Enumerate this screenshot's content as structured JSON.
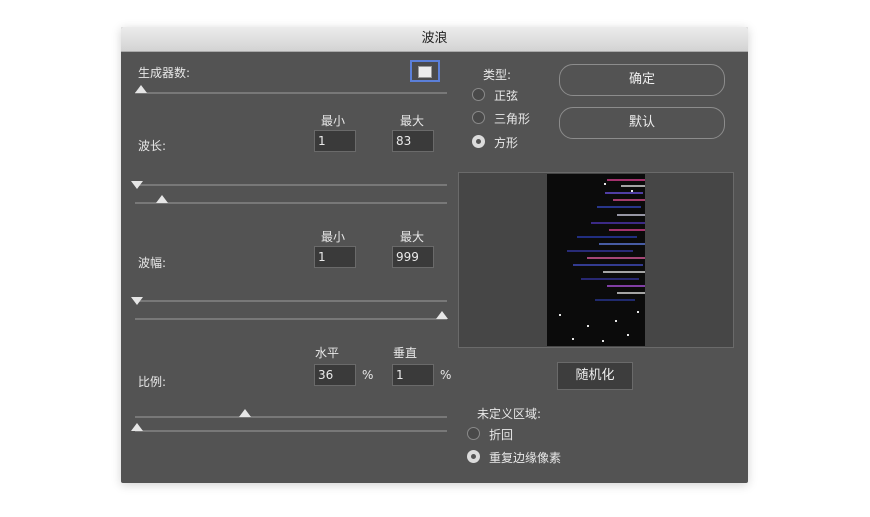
{
  "dialog": {
    "title": "波浪"
  },
  "generators": {
    "label": "生成器数:"
  },
  "wavelength": {
    "label": "波长:",
    "min_label": "最小",
    "max_label": "最大",
    "min_value": "1",
    "max_value": "83"
  },
  "amplitude": {
    "label": "波幅:",
    "min_label": "最小",
    "max_label": "最大",
    "min_value": "1",
    "max_value": "999"
  },
  "scale": {
    "label": "比例:",
    "horizontal_label": "水平",
    "vertical_label": "垂直",
    "horizontal_value": "36",
    "vertical_value": "1",
    "percent": "%"
  },
  "type": {
    "label": "类型:",
    "options": [
      "正弦",
      "三角形",
      "方形"
    ],
    "selected": "方形"
  },
  "buttons": {
    "ok": "确定",
    "default": "默认",
    "randomize": "随机化"
  },
  "undefined_area": {
    "label": "未定义区域:",
    "options": [
      "折回",
      "重复边缘像素"
    ],
    "selected": "重复边缘像素"
  },
  "sliders": {
    "generators": 0.0,
    "wavelength_min": 0.0,
    "wavelength_max": 0.09,
    "amplitude_min": 0.0,
    "amplitude_max": 1.0,
    "scale_horizontal": 0.36,
    "scale_vertical": 0.0
  },
  "colors": {
    "panel": "#535353",
    "accent": "#5b7fd8"
  },
  "icons": [
    "generator-preview-icon"
  ]
}
